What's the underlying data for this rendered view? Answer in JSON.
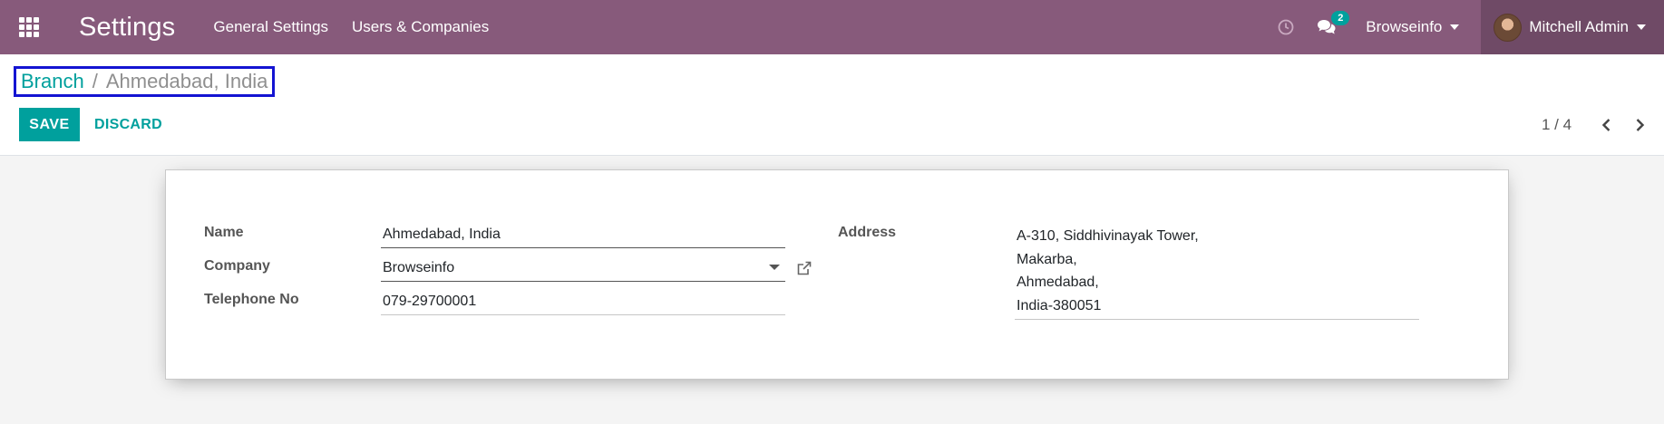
{
  "navbar": {
    "app_title": "Settings",
    "menu": [
      "General Settings",
      "Users & Companies"
    ],
    "chat_count": "2",
    "company": "Browseinfo",
    "user": "Mitchell Admin",
    "bg_color": "#875a7b"
  },
  "breadcrumb": {
    "parent": "Branch",
    "separator": "/",
    "current": "Ahmedabad, India"
  },
  "buttons": {
    "save": "SAVE",
    "discard": "DISCARD"
  },
  "pager": {
    "value": "1 / 4"
  },
  "form": {
    "name_label": "Name",
    "name_value": "Ahmedabad, India",
    "company_label": "Company",
    "company_value": "Browseinfo",
    "telephone_label": "Telephone No",
    "telephone_value": "079-29700001",
    "address_label": "Address",
    "address_lines": [
      "A-310, Siddhivinayak Tower,",
      "Makarba,",
      "Ahmedabad,",
      "India-380051"
    ]
  },
  "colors": {
    "accent": "#00a09d",
    "highlight_border": "#1414d2"
  }
}
